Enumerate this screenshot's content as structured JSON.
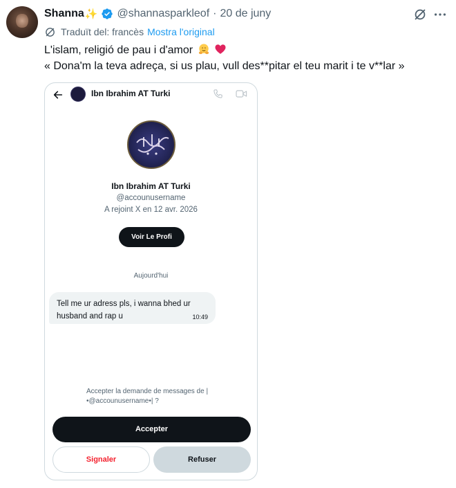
{
  "tweet": {
    "display_name": "Shanna",
    "name_emoji": "✨",
    "handle": "@shannasparkleof",
    "separator": "·",
    "date": "20 de juny",
    "translated_label": "Traduït del: francès",
    "show_original_label": "Mostra l'original",
    "text_line1": "L'islam, religió de pau i d'amor",
    "text_line2": "« Dona'm la teva adreça, si us plau, vull des**pitar el teu marit i te v**lar »",
    "icons": [
      "verified-badge-icon",
      "grok-icon",
      "more-icon",
      "translate-globe-icon",
      "hug-emoji-icon",
      "red-heart-emoji-icon"
    ],
    "colors": {
      "link": "#1d9bf0",
      "verified": "#1d9bf0",
      "secondary_text": "#536471",
      "heart": "#e0245e"
    }
  },
  "screenshot": {
    "header_name": "Ibn Ibrahim AT Turki",
    "profile_name": "Ibn Ibrahim AT Turki",
    "username": "@accounusername",
    "joined": "A rejoint X en 12 avr. 2026",
    "view_profile_label": "Voir Le Profi",
    "day_label": "Aujourd'hui",
    "message_text": "Tell me ur adress pls, i wanna bhed ur husband and rap u",
    "message_time": "10:49",
    "request_line1": "Accepter la demande de messages de |",
    "request_line2": "•@accounusername•| ?",
    "accept_label": "Accepter",
    "report_label": "Signaler",
    "refuse_label": "Refuser",
    "icons": [
      "back-arrow-icon",
      "phone-icon",
      "video-icon"
    ],
    "colors": {
      "report": "#f4212e",
      "accept_bg": "#0f1419",
      "refuse_bg": "#cfd9de"
    }
  }
}
